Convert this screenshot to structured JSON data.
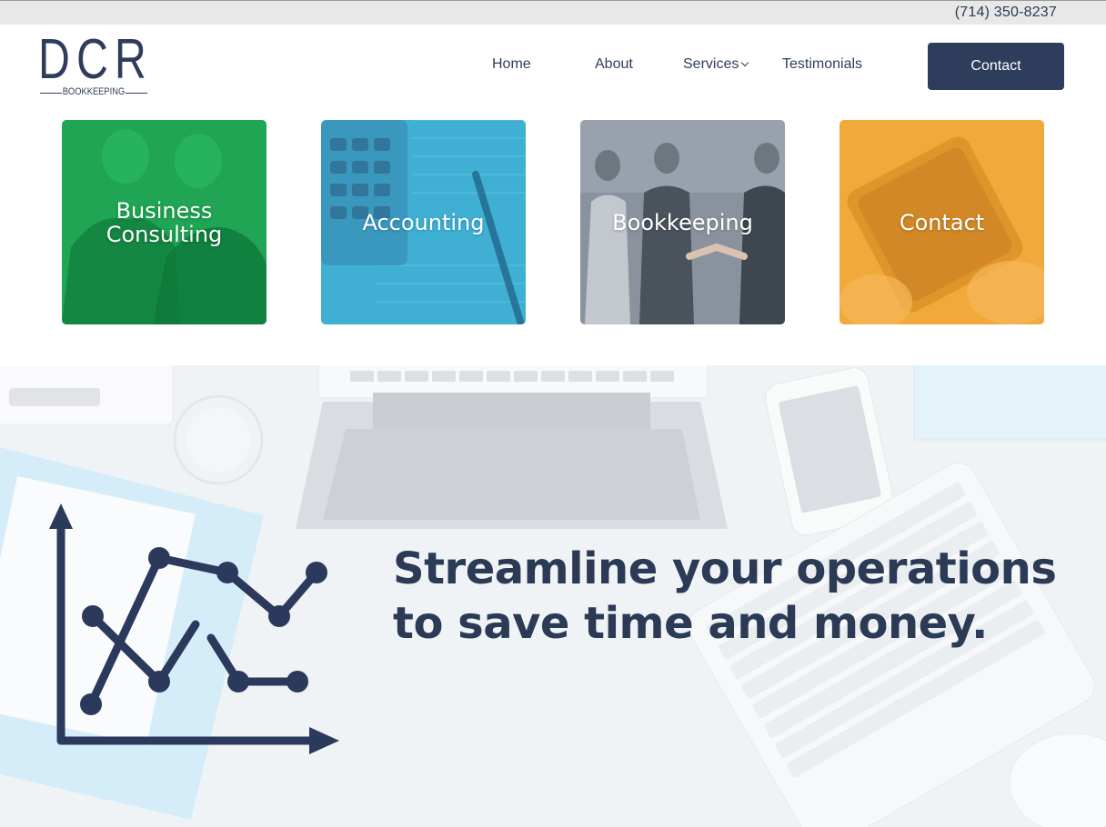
{
  "topbar": {
    "phone": "(714) 350-8237"
  },
  "logo": {
    "mark": "DCR",
    "tagline": "BOOKKEEPING"
  },
  "nav": {
    "items": [
      {
        "label": "Home"
      },
      {
        "label": "About"
      },
      {
        "label": "Services"
      },
      {
        "label": "Testimonials"
      }
    ],
    "cta_label": "Contact"
  },
  "tiles": [
    {
      "line1": "Business",
      "line2": "Consulting",
      "color": "#1fa553"
    },
    {
      "line1": "Accounting",
      "color": "#3fb0d4"
    },
    {
      "line1": "Bookkeeping",
      "color": "#7d8792"
    },
    {
      "line1": "Contact",
      "color": "#f2a93b"
    }
  ],
  "hero": {
    "headline_line1": "Streamline your operations",
    "headline_line2": "to save time and money."
  },
  "colors": {
    "brand": "#2f3d5c",
    "topbar": "#e8e8e8"
  }
}
